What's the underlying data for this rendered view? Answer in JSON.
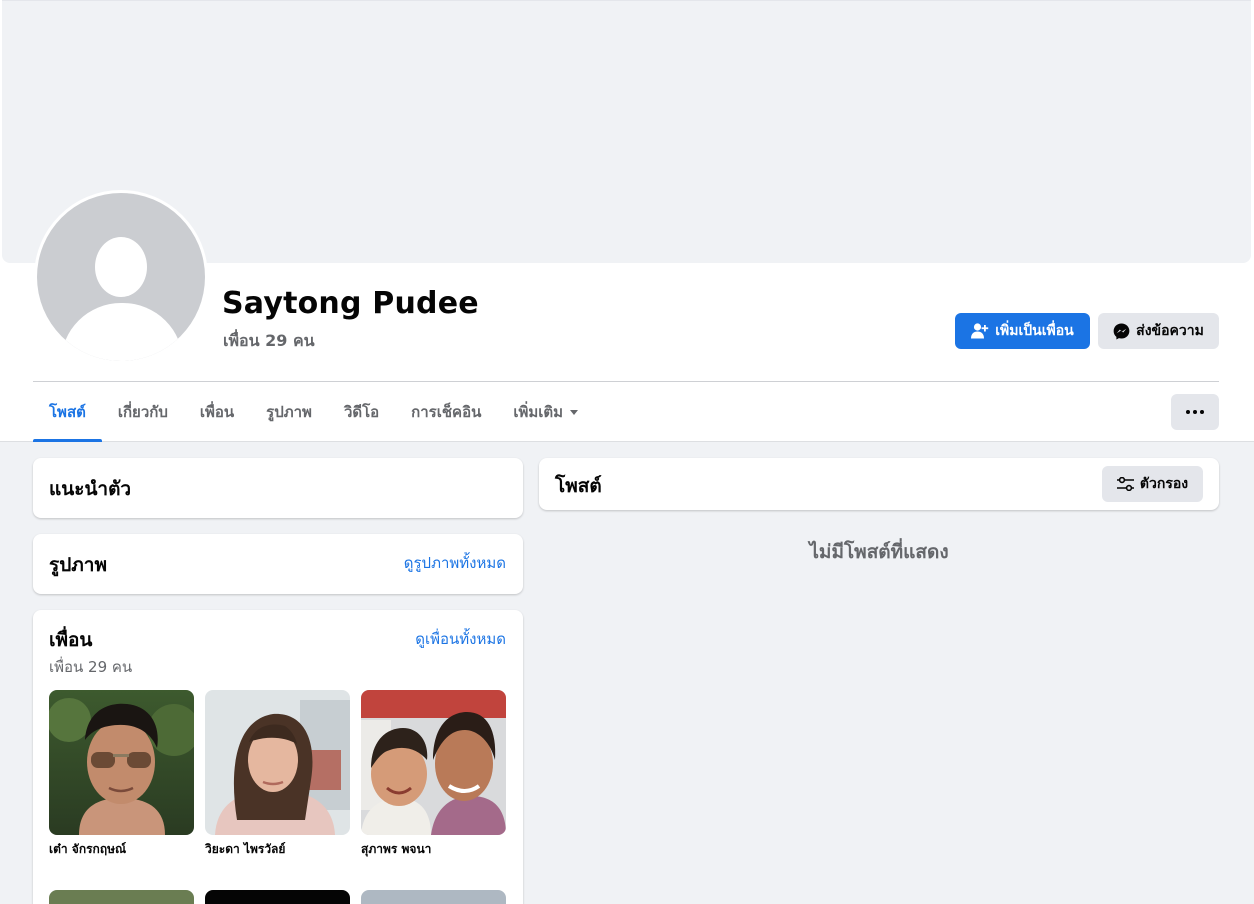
{
  "profile": {
    "name": "Saytong Pudee",
    "friends_count_label": "เพื่อน 29 คน",
    "add_friend_label": "เพิ่มเป็นเพื่อน",
    "message_label": "ส่งข้อความ"
  },
  "tabs": [
    {
      "label": "โพสต์",
      "active": true
    },
    {
      "label": "เกี่ยวกับ"
    },
    {
      "label": "เพื่อน"
    },
    {
      "label": "รูปภาพ"
    },
    {
      "label": "วิดีโอ"
    },
    {
      "label": "การเช็คอิน"
    },
    {
      "label": "เพิ่มเติม"
    }
  ],
  "intro": {
    "title": "แนะนำตัว"
  },
  "photos": {
    "title": "รูปภาพ",
    "see_all": "ดูรูปภาพทั้งหมด"
  },
  "friends": {
    "title": "เพื่อน",
    "see_all": "ดูเพื่อนทั้งหมด",
    "count_label": "เพื่อน 29 คน",
    "items": [
      {
        "name": "เต๋า จักรกฤษณ์"
      },
      {
        "name": "วิยะดา ไพรวัลย์"
      },
      {
        "name": "สุภาพร พจนา"
      }
    ]
  },
  "posts": {
    "title": "โพสต์",
    "filter_label": "ตัวกรอง",
    "empty_text": "ไม่มีโพสต์ที่แสดง"
  },
  "colors": {
    "accent": "#1b74e4",
    "background": "#f0f2f5",
    "secondary_text": "#65676b"
  },
  "icons": [
    "add-friend-icon",
    "messenger-icon",
    "more-dots-icon",
    "filter-icon",
    "chevron-down-icon"
  ]
}
